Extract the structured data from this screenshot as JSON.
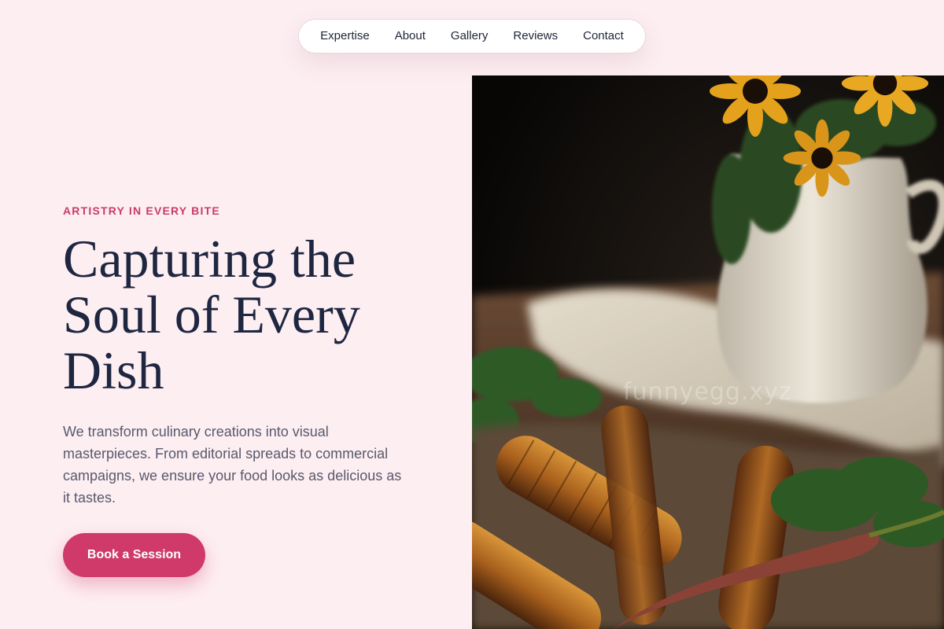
{
  "nav": {
    "items": [
      {
        "label": "Expertise"
      },
      {
        "label": "About"
      },
      {
        "label": "Gallery"
      },
      {
        "label": "Reviews"
      },
      {
        "label": "Contact"
      }
    ]
  },
  "hero": {
    "eyebrow": "ARTISTRY IN EVERY BITE",
    "headline_lines": [
      "Capturing the",
      "Soul of Every",
      "Dish"
    ],
    "subtitle": "We transform culinary creations into visual masterpieces. From editorial spreads to commercial campaigns, we ensure your food looks as delicious as it tastes.",
    "cta_label": "Book a Session",
    "image": {
      "subject": "grilled corn with white pitcher and yellow flowers",
      "watermark": "funnyegg.xyz"
    }
  },
  "colors": {
    "background": "#fdeef2",
    "accent": "#cf3a6b",
    "heading": "#1e2640",
    "body_text": "#585a6c"
  }
}
